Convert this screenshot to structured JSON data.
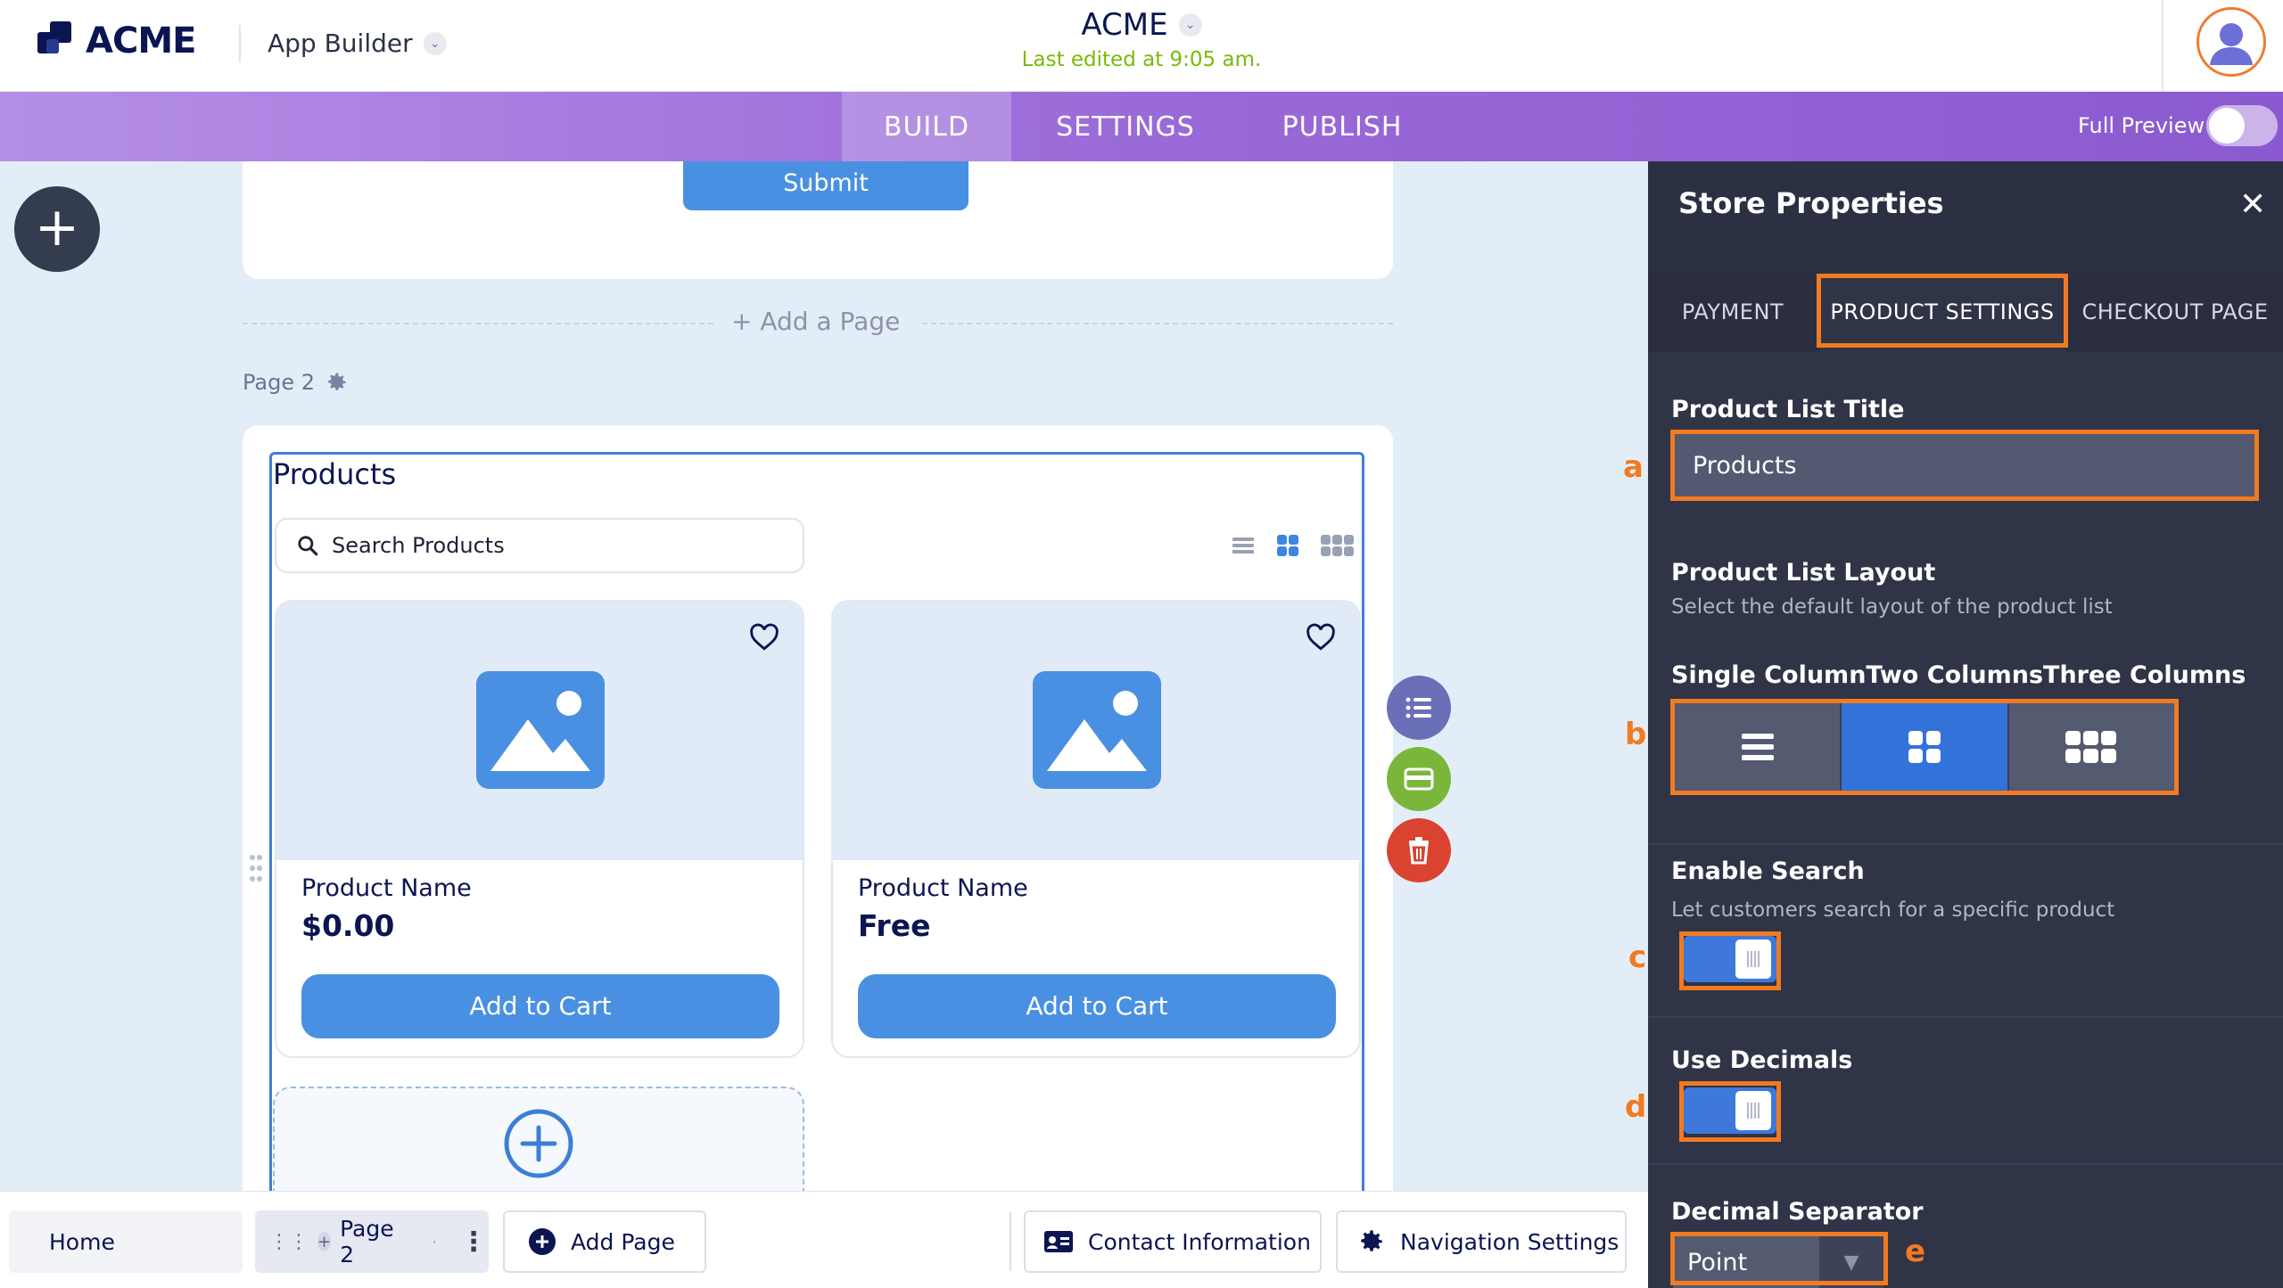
{
  "header": {
    "logo_text": "ACME",
    "app_builder_label": "App Builder",
    "app_title": "ACME",
    "last_edited": "Last edited at 9:05 am."
  },
  "navbar": {
    "tabs": [
      {
        "label": "BUILD",
        "active": true
      },
      {
        "label": "SETTINGS",
        "active": false
      },
      {
        "label": "PUBLISH",
        "active": false
      }
    ],
    "full_preview_label": "Full Preview"
  },
  "canvas": {
    "submit_label": "Submit",
    "add_page_label": "+ Add a Page",
    "page_label": "Page 2",
    "products_title": "Products",
    "search_placeholder": "Search Products",
    "products": [
      {
        "name": "Product Name",
        "price": "$0.00",
        "button": "Add to Cart"
      },
      {
        "name": "Product Name",
        "price": "Free",
        "button": "Add to Cart"
      }
    ]
  },
  "bottombar": {
    "home": "Home",
    "page2": "Page 2",
    "add_page": "Add Page",
    "contact": "Contact Information",
    "nav_settings": "Navigation Settings"
  },
  "panel": {
    "title": "Store Properties",
    "tabs": [
      {
        "label": "PAYMENT",
        "active": false
      },
      {
        "label": "PRODUCT SETTINGS",
        "active": true
      },
      {
        "label": "CHECKOUT PAGE",
        "active": false
      }
    ],
    "product_list_title_label": "Product List Title",
    "product_list_title_value": "Products",
    "layout_label": "Product List Layout",
    "layout_desc": "Select the default layout of the product list",
    "layout_options_label": "Single ColumnTwo ColumnsThree Columns",
    "layout_selected": "Two Columns",
    "enable_search_label": "Enable Search",
    "enable_search_desc": "Let customers search for a specific product",
    "enable_search_on": true,
    "use_decimals_label": "Use Decimals",
    "use_decimals_on": true,
    "decimal_separator_label": "Decimal Separator",
    "decimal_separator_value": "Point"
  },
  "annotations": {
    "a": "a",
    "b": "b",
    "c": "c",
    "d": "d",
    "e": "e"
  },
  "colors": {
    "accent": "#4a90e2",
    "highlight": "#f27a21",
    "nav_gradient_start": "#b58fe6",
    "nav_gradient_end": "#8b5ad0",
    "panel_bg": "#2f3447",
    "last_edited": "#78bb07"
  }
}
